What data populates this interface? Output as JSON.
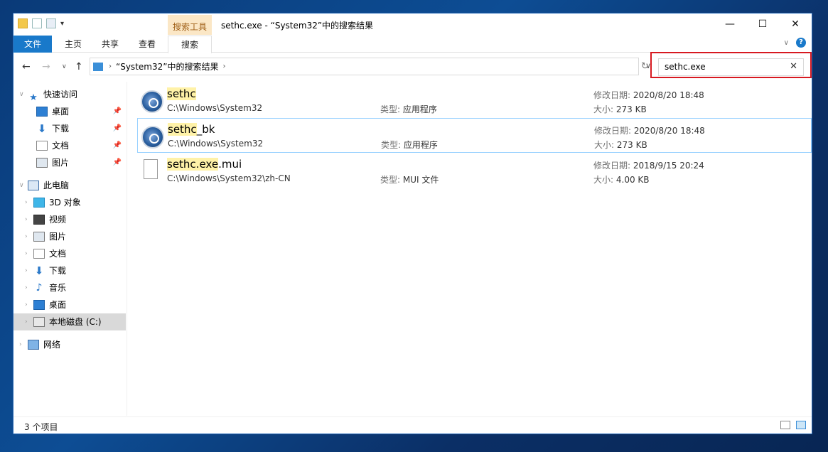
{
  "window": {
    "title": "sethc.exe - “System32”中的搜索结果",
    "context_group": "搜索工具",
    "buttons": {
      "minimize": "—",
      "maximize": "☐",
      "close": "✕"
    }
  },
  "ribbon": {
    "tabs": [
      {
        "label": "文件"
      },
      {
        "label": "主页"
      },
      {
        "label": "共享"
      },
      {
        "label": "查看"
      },
      {
        "label": "搜索"
      }
    ],
    "help_label": "?"
  },
  "nav": {
    "address": "“System32”中的搜索结果",
    "search_value": "sethc.exe"
  },
  "sidebar": {
    "items": [
      {
        "label": "快速访问",
        "icon": "star-icon"
      },
      {
        "label": "桌面",
        "icon": "desktop-icon",
        "pinned": true
      },
      {
        "label": "下载",
        "icon": "download-icon",
        "pinned": true
      },
      {
        "label": "文档",
        "icon": "document-icon",
        "pinned": true
      },
      {
        "label": "图片",
        "icon": "pictures-icon",
        "pinned": true
      },
      {
        "label": "此电脑",
        "icon": "computer-icon"
      },
      {
        "label": "3D 对象",
        "icon": "3d-objects-icon"
      },
      {
        "label": "视频",
        "icon": "videos-icon"
      },
      {
        "label": "图片",
        "icon": "pictures-icon"
      },
      {
        "label": "文档",
        "icon": "document-icon"
      },
      {
        "label": "下载",
        "icon": "download-icon"
      },
      {
        "label": "音乐",
        "icon": "music-icon"
      },
      {
        "label": "桌面",
        "icon": "desktop-icon"
      },
      {
        "label": "本地磁盘 (C:)",
        "icon": "drive-icon",
        "selected": true
      },
      {
        "label": "网络",
        "icon": "network-icon"
      }
    ]
  },
  "results": [
    {
      "name_hl": "sethc",
      "name_rest": "",
      "path": "C:\\Windows\\System32",
      "type_label": "类型:",
      "type": "应用程序",
      "date_label": "修改日期:",
      "date": "2020/8/20 18:48",
      "size_label": "大小:",
      "size": "273 KB",
      "icon": "application-icon"
    },
    {
      "name_hl": "sethc",
      "name_rest": "_bk",
      "path": "C:\\Windows\\System32",
      "type_label": "类型:",
      "type": "应用程序",
      "date_label": "修改日期:",
      "date": "2020/8/20 18:48",
      "size_label": "大小:",
      "size": "273 KB",
      "icon": "application-icon"
    },
    {
      "name_hl": "sethc.exe",
      "name_rest": ".mui",
      "path": "C:\\Windows\\System32\\zh-CN",
      "type_label": "类型:",
      "type": "MUI 文件",
      "date_label": "修改日期:",
      "date": "2018/9/15 20:24",
      "size_label": "大小:",
      "size": "4.00 KB",
      "icon": "file-icon"
    }
  ],
  "status": {
    "count": "3 个项目"
  },
  "colors": {
    "accent": "#1979ca",
    "highlight_border": "#d71920",
    "match_highlight": "#fff2a8"
  }
}
